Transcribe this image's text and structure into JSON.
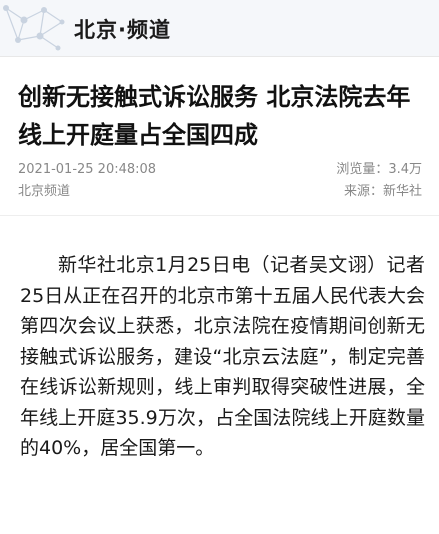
{
  "header": {
    "channel_title": "北京·频道",
    "logo_icon": "network-dots-icon"
  },
  "article": {
    "headline": "创新无接触式诉讼服务 北京法院去年线上开庭量占全国四成",
    "datetime": "2021-01-25 20:48:08",
    "views": "浏览量：3.4万",
    "channel": "北京频道",
    "source": "来源：新华社",
    "body": "新华社北京1月25日电（记者吴文诩）记者25日从正在召开的北京市第十五届人民代表大会第四次会议上获悉，北京法院在疫情期间创新无接触式诉讼服务，建设“北京云法庭”，制定完善在线诉讼新规则，线上审判取得突破性进展，全年线上开庭35.9万次，占全国法院线上开庭数量的40%，居全国第一。"
  },
  "colors": {
    "header_bg": "#f5f7fa",
    "logo_lines": "#c9d3e0",
    "meta_text": "#888888"
  }
}
